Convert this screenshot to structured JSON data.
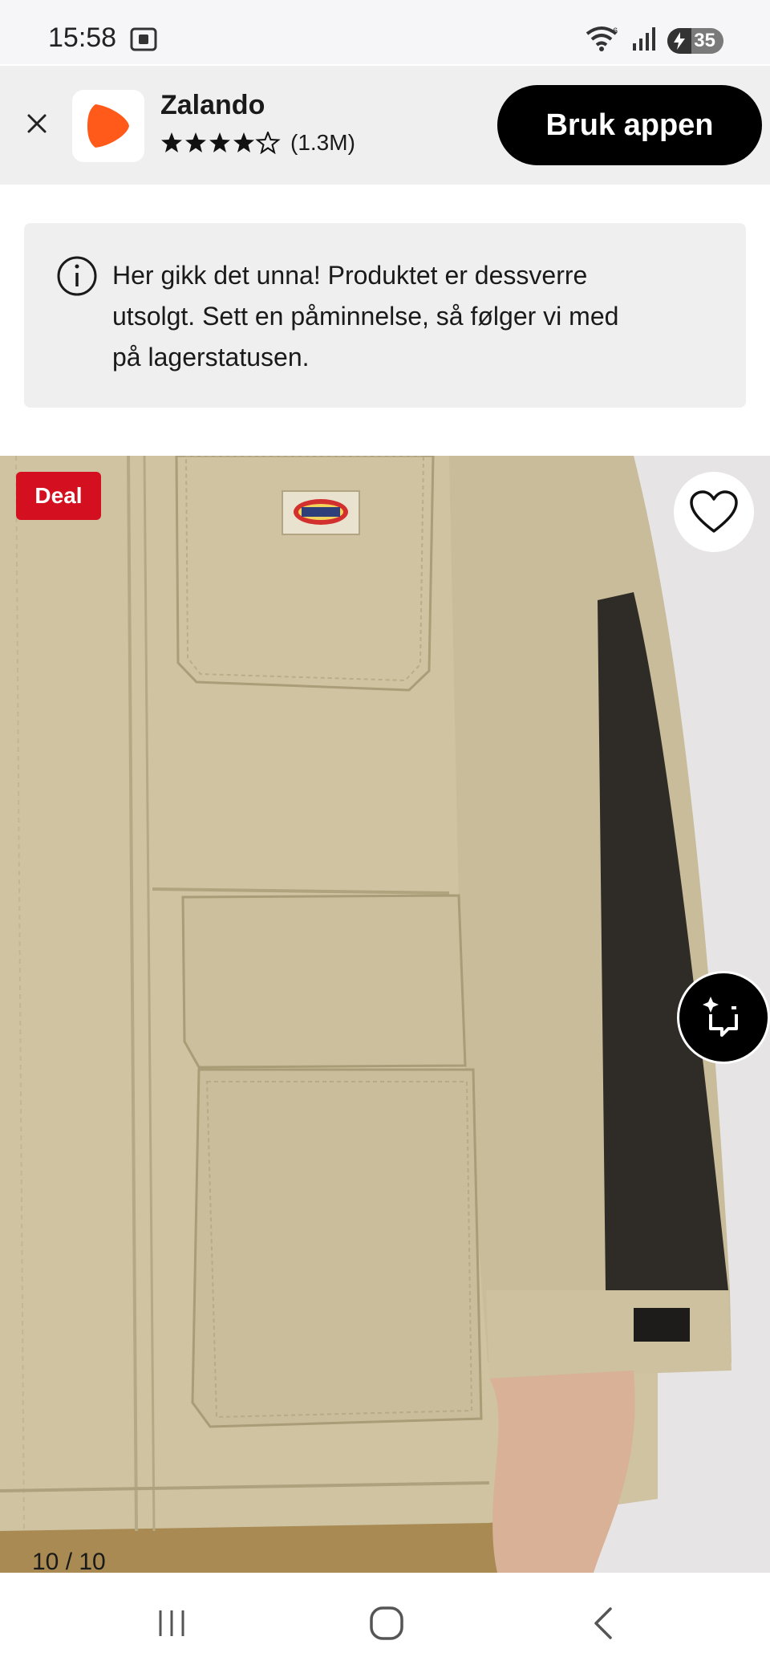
{
  "status_bar": {
    "time": "15:58",
    "battery": "35",
    "icons": [
      "screen-capture-icon",
      "wifi-icon",
      "signal-icon",
      "battery-charging-icon"
    ]
  },
  "app_banner": {
    "app_name": "Zalando",
    "rating_stars": 4.5,
    "rating_count": "(1.3M)",
    "cta_label": "Bruk appen",
    "brand_color": "#ff6900"
  },
  "notice": {
    "line1": "Her gikk det unna! Produktet er dessverre",
    "line2": "utsolgt. Sett en påminnelse, så følger vi med",
    "line3": "på lagerstatusen."
  },
  "product": {
    "badge": "Deal",
    "badge_color": "#d40f1f",
    "counter": "10 / 10"
  },
  "nav": {
    "icons": [
      "recent-apps-icon",
      "home-icon",
      "back-icon"
    ]
  }
}
